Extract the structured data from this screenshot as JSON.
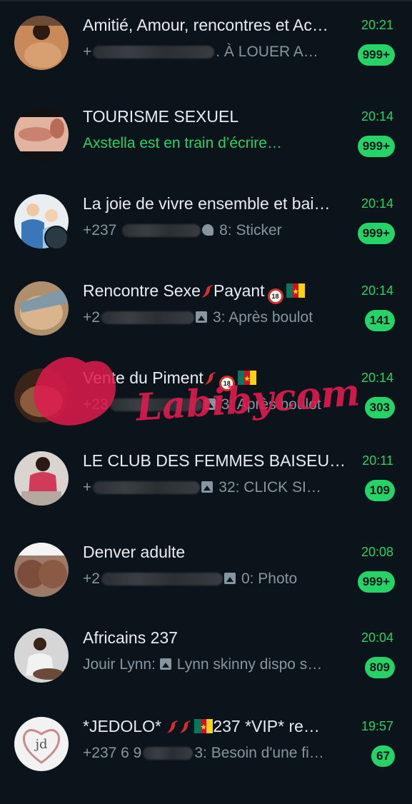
{
  "colors": {
    "background": "#0b141a",
    "accent_green": "#25d366",
    "title_text": "#e9edef",
    "secondary_text": "#8696a0",
    "watermark_red": "#e01a4f"
  },
  "watermark": {
    "text": "Labibycom"
  },
  "chats": [
    {
      "title": "Amitié, Amour, rencontres et Ac…",
      "preview_prefix": "+",
      "preview_text": ". À LOUER  A…",
      "time": "20:21",
      "unread": "999+"
    },
    {
      "title": "TOURISME SEXUEL",
      "preview_text": "Axstella est en train d’écrire…",
      "time": "20:14",
      "unread": "999+"
    },
    {
      "title": "La joie de vivre ensemble et bai…",
      "preview_prefix": "+237 ",
      "preview_text": "8: Sticker",
      "time": "20:14",
      "unread": "999+"
    },
    {
      "title_a": "Rencontre Sexe",
      "title_b": "Payant",
      "preview_prefix": "+2",
      "preview_text": "3: Après boulot",
      "time": "20:14",
      "unread": "141"
    },
    {
      "title_a": "Vente du Piment",
      "preview_prefix": "+23",
      "preview_text": "3: Après boulot",
      "time": "20:14",
      "unread": "303"
    },
    {
      "title": "LE CLUB DES FEMMES BAISEU…",
      "preview_prefix": "+",
      "preview_text": "32: CLICK SI…",
      "time": "20:11",
      "unread": "109"
    },
    {
      "title": "Denver adulte",
      "preview_prefix": "+2",
      "preview_text": "0: Photo",
      "time": "20:08",
      "unread": "999+"
    },
    {
      "title": "Africains 237",
      "preview_sender": "Jouir Lynn:",
      "preview_text": "Lynn skinny dispo s…",
      "time": "20:04",
      "unread": "809"
    },
    {
      "title_a": "*JEDOLO*",
      "title_b": "237 *VIP* re…",
      "preview_prefix": "+237 6 9",
      "preview_text": "3: Besoin d'une fi…",
      "time": "19:57",
      "unread": "67"
    }
  ]
}
